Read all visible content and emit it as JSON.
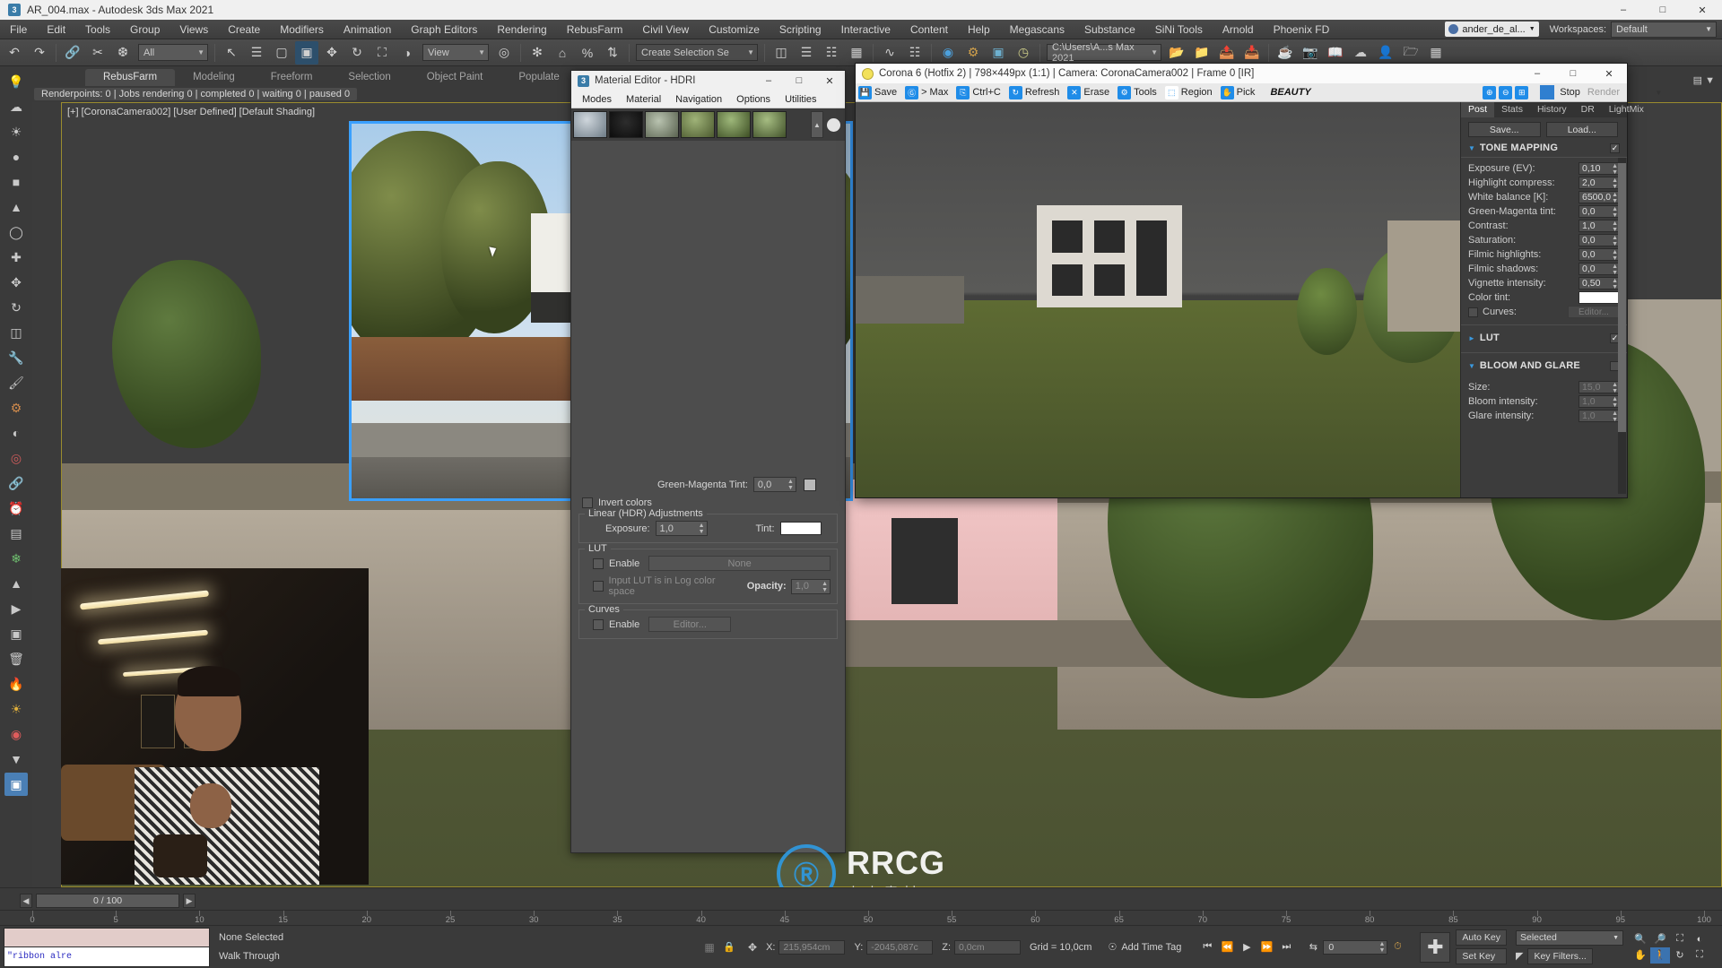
{
  "titlebar": {
    "icon": "max-app-icon",
    "title": "AR_004.max - Autodesk 3ds Max 2021",
    "minimize": "–",
    "maximize": "□",
    "close": "✕"
  },
  "menubar": {
    "items": [
      "File",
      "Edit",
      "Tools",
      "Group",
      "Views",
      "Create",
      "Modifiers",
      "Animation",
      "Graph Editors",
      "Rendering",
      "RebusFarm",
      "Civil View",
      "Customize",
      "Scripting",
      "Interactive",
      "Content",
      "Help",
      "Megascans",
      "Substance",
      "SiNi Tools",
      "Arnold",
      "Phoenix FD"
    ],
    "user": "ander_de_al...",
    "workspaces_label": "Workspaces:",
    "workspace_value": "Default"
  },
  "toolbar": {
    "selection_filter": "All",
    "reference_coord": "View",
    "named_selection": "Create Selection Se",
    "project_folder": "C:\\Users\\A...s Max 2021",
    "buttons": [
      {
        "name": "undo-button",
        "glyph": "↶"
      },
      {
        "name": "redo-button",
        "glyph": "↷"
      },
      {
        "name": "select-link-button",
        "glyph": "🔗"
      },
      {
        "name": "unlink-button",
        "glyph": "✂"
      },
      {
        "name": "bind-space-warp-button",
        "glyph": "❆"
      },
      {
        "name": "select-object-button",
        "glyph": "↖"
      },
      {
        "name": "select-by-name-button",
        "glyph": "☰"
      },
      {
        "name": "rectangular-select-button",
        "glyph": "▢"
      },
      {
        "name": "window-crossing-button",
        "glyph": "▣"
      },
      {
        "name": "select-move-button",
        "glyph": "✥"
      },
      {
        "name": "select-rotate-button",
        "glyph": "↻"
      },
      {
        "name": "select-scale-button",
        "glyph": "⛶"
      },
      {
        "name": "placement-tool-button",
        "glyph": "◑"
      }
    ]
  },
  "ribbon": {
    "tabs": [
      "RebusFarm",
      "Modeling",
      "Freeform",
      "Selection",
      "Object Paint",
      "Populate"
    ],
    "active_tab": "RebusFarm",
    "status": "Renderpoints: 0 | Jobs rendering 0 | completed 0 | waiting 0 | paused 0"
  },
  "viewport": {
    "label": "[+] [CoronaCamera002] [User Defined] [Default Shading]"
  },
  "material_editor": {
    "title": "Material Editor - HDRI",
    "icon": "max-app-icon",
    "minimize": "–",
    "maximize": "□",
    "close": "✕",
    "menus": [
      "Modes",
      "Material",
      "Navigation",
      "Options",
      "Utilities"
    ],
    "green_magenta_label": "Green-Magenta Tint:",
    "green_magenta_value": "0,0",
    "invert_colors": "Invert colors",
    "linear_group": "Linear (HDR) Adjustments",
    "exposure_label": "Exposure:",
    "exposure_value": "1,0",
    "tint_label": "Tint:",
    "lut_group": "LUT",
    "lut_enable": "Enable",
    "lut_none": "None",
    "lut_log_space": "Input LUT is in Log color space",
    "opacity_label": "Opacity:",
    "opacity_value": "1,0",
    "curves_group": "Curves",
    "curves_enable": "Enable",
    "curves_editor": "Editor..."
  },
  "vfb": {
    "title": "Corona 6 (Hotfix 2) | 798×449px (1:1) | Camera: CoronaCamera002 | Frame 0 [IR]",
    "minimize": "–",
    "maximize": "□",
    "close": "✕",
    "tools": [
      {
        "name": "save-button",
        "label": "Save",
        "glyph": "💾"
      },
      {
        "name": "to-max-button",
        "label": "> Max",
        "glyph": "Ⓖ"
      },
      {
        "name": "copy-button",
        "label": "Ctrl+C",
        "glyph": "⎘"
      },
      {
        "name": "refresh-button",
        "label": "Refresh",
        "glyph": "↻"
      },
      {
        "name": "erase-button",
        "label": "Erase",
        "glyph": "✕"
      },
      {
        "name": "tools-button",
        "label": "Tools",
        "glyph": "⚙"
      },
      {
        "name": "region-button",
        "label": "Region",
        "glyph": "⬚"
      },
      {
        "name": "pick-button",
        "label": "Pick",
        "glyph": "✋"
      }
    ],
    "channel": "BEAUTY",
    "zoom_in": "⊕",
    "zoom_out": "⊖",
    "zoom_fit": "⊞",
    "stop_label": "Stop",
    "render_label": "Render",
    "tabs": [
      "Post",
      "Stats",
      "History",
      "DR",
      "LightMix"
    ],
    "active_tab": "Post",
    "save_btn": "Save...",
    "load_btn": "Load...",
    "tone_mapping": {
      "title": "TONE MAPPING",
      "enabled": true,
      "rows": [
        {
          "label": "Exposure (EV):",
          "value": "0,10",
          "dim": false
        },
        {
          "label": "Highlight compress:",
          "value": "2,0",
          "dim": false
        },
        {
          "label": "White balance [K]:",
          "value": "6500,0",
          "dim": false
        },
        {
          "label": "Green-Magenta tint:",
          "value": "0,0",
          "dim": false
        },
        {
          "label": "Contrast:",
          "value": "1,0",
          "dim": false
        },
        {
          "label": "Saturation:",
          "value": "0,0",
          "dim": false
        },
        {
          "label": "Filmic highlights:",
          "value": "0,0",
          "dim": false
        },
        {
          "label": "Filmic shadows:",
          "value": "0,0",
          "dim": false
        },
        {
          "label": "Vignette intensity:",
          "value": "0,50",
          "dim": false
        }
      ],
      "color_tint_label": "Color tint:",
      "curves_label": "Curves:",
      "curves_editor": "Editor..."
    },
    "lut": {
      "title": "LUT",
      "enabled": true
    },
    "bloom": {
      "title": "BLOOM AND GLARE",
      "enabled": false,
      "rows": [
        {
          "label": "Size:",
          "value": "15,0",
          "dim": true
        },
        {
          "label": "Bloom intensity:",
          "value": "1,0",
          "dim": true
        },
        {
          "label": "Glare intensity:",
          "value": "1,0",
          "dim": true
        }
      ]
    }
  },
  "timeline": {
    "frame_range": "0 / 100",
    "prev_glyph": "◀",
    "next_glyph": "▶",
    "ticks": [
      0,
      5,
      10,
      15,
      20,
      25,
      30,
      35,
      40,
      45,
      50,
      55,
      60,
      65,
      70,
      75,
      80,
      85,
      90,
      95,
      100
    ]
  },
  "statusbar": {
    "listener_text": "\"ribbon alre",
    "selection_status": "None Selected",
    "nav_mode": "Walk Through",
    "lock_icon": "🔒",
    "coord_x_label": "X:",
    "coord_x": "215,954cm",
    "coord_y_label": "Y:",
    "coord_y": "-2045,087c",
    "coord_z_label": "Z:",
    "coord_z": "0,0cm",
    "grid": "Grid = 10,0cm",
    "add_time_tag": "Add Time Tag",
    "auto_key": "Auto Key",
    "set_key": "Set Key",
    "key_mode": "Selected",
    "key_filters": "Key Filters...",
    "frame_value": "0"
  },
  "watermark": {
    "logo": "Ⓡ",
    "line1": "RRCG",
    "line2": "人人素材"
  }
}
